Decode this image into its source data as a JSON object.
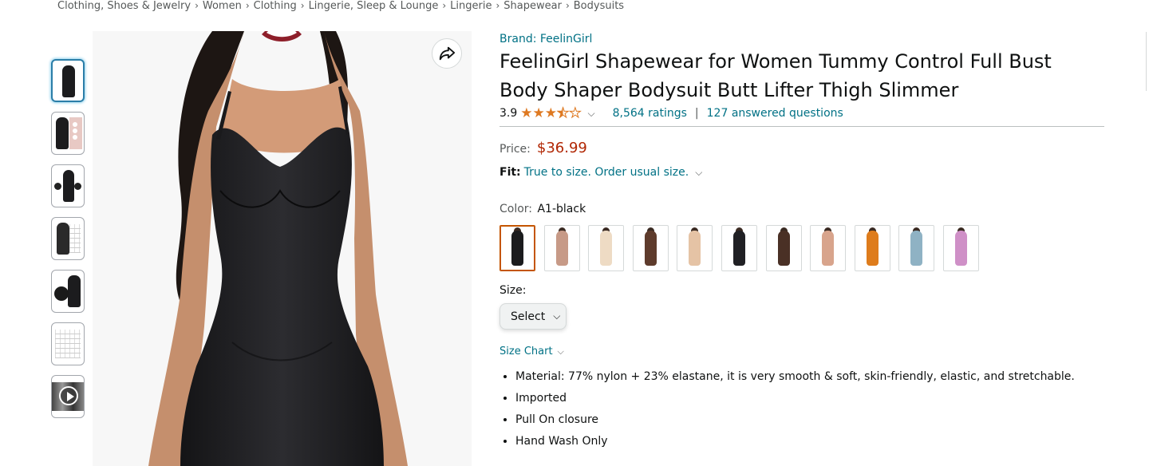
{
  "breadcrumb": [
    "Clothing, Shoes & Jewelry",
    "Women",
    "Clothing",
    "Lingerie, Sleep & Lounge",
    "Lingerie",
    "Shapewear",
    "Bodysuits"
  ],
  "breadcrumb_separator": "›",
  "product": {
    "brand": "Brand: FeelinGirl",
    "title": "FeelinGirl Shapewear for Women Tummy Control Full Bust Body Shaper Bodysuit Butt Lifter Thigh Slimmer",
    "rating": "3.9",
    "rating_value": 3.9,
    "ratings_count": "8,564 ratings",
    "answered_questions": "127 answered questions",
    "price_label": "Price:",
    "price": "$36.99",
    "fit_label": "Fit:",
    "fit_value": "True to size. Order usual size.",
    "color_label": "Color:",
    "color_value": "A1-black",
    "size_label": "Size:",
    "size_select": "Select",
    "size_chart": "Size Chart",
    "bullets": [
      "Material: 77% nylon + 23% elastane, it is very smooth & soft, skin-friendly, elastic, and stretchable.",
      "Imported",
      "Pull On closure",
      "Hand Wash Only"
    ]
  },
  "colors": {
    "link": "#007185",
    "price": "#b12704",
    "star": "#de7921",
    "selected_swatch": "#c45500"
  },
  "swatches": [
    {
      "color": "#1b1b1d",
      "selected": true
    },
    {
      "color": "#c79a87",
      "selected": false
    },
    {
      "color": "#eedbc4",
      "selected": false
    },
    {
      "color": "#5e3b2c",
      "selected": false
    },
    {
      "color": "#e5c3a5",
      "selected": false
    },
    {
      "color": "#202024",
      "selected": false
    },
    {
      "color": "#4a3025",
      "selected": false
    },
    {
      "color": "#d8a48c",
      "selected": false
    },
    {
      "color": "#de7c1c",
      "selected": false
    },
    {
      "color": "#8fb2c4",
      "selected": false
    },
    {
      "color": "#cf90c7",
      "selected": false
    }
  ],
  "icons": {
    "share": "share-icon",
    "play": "play-icon",
    "chevron": "chevron-down-icon"
  }
}
